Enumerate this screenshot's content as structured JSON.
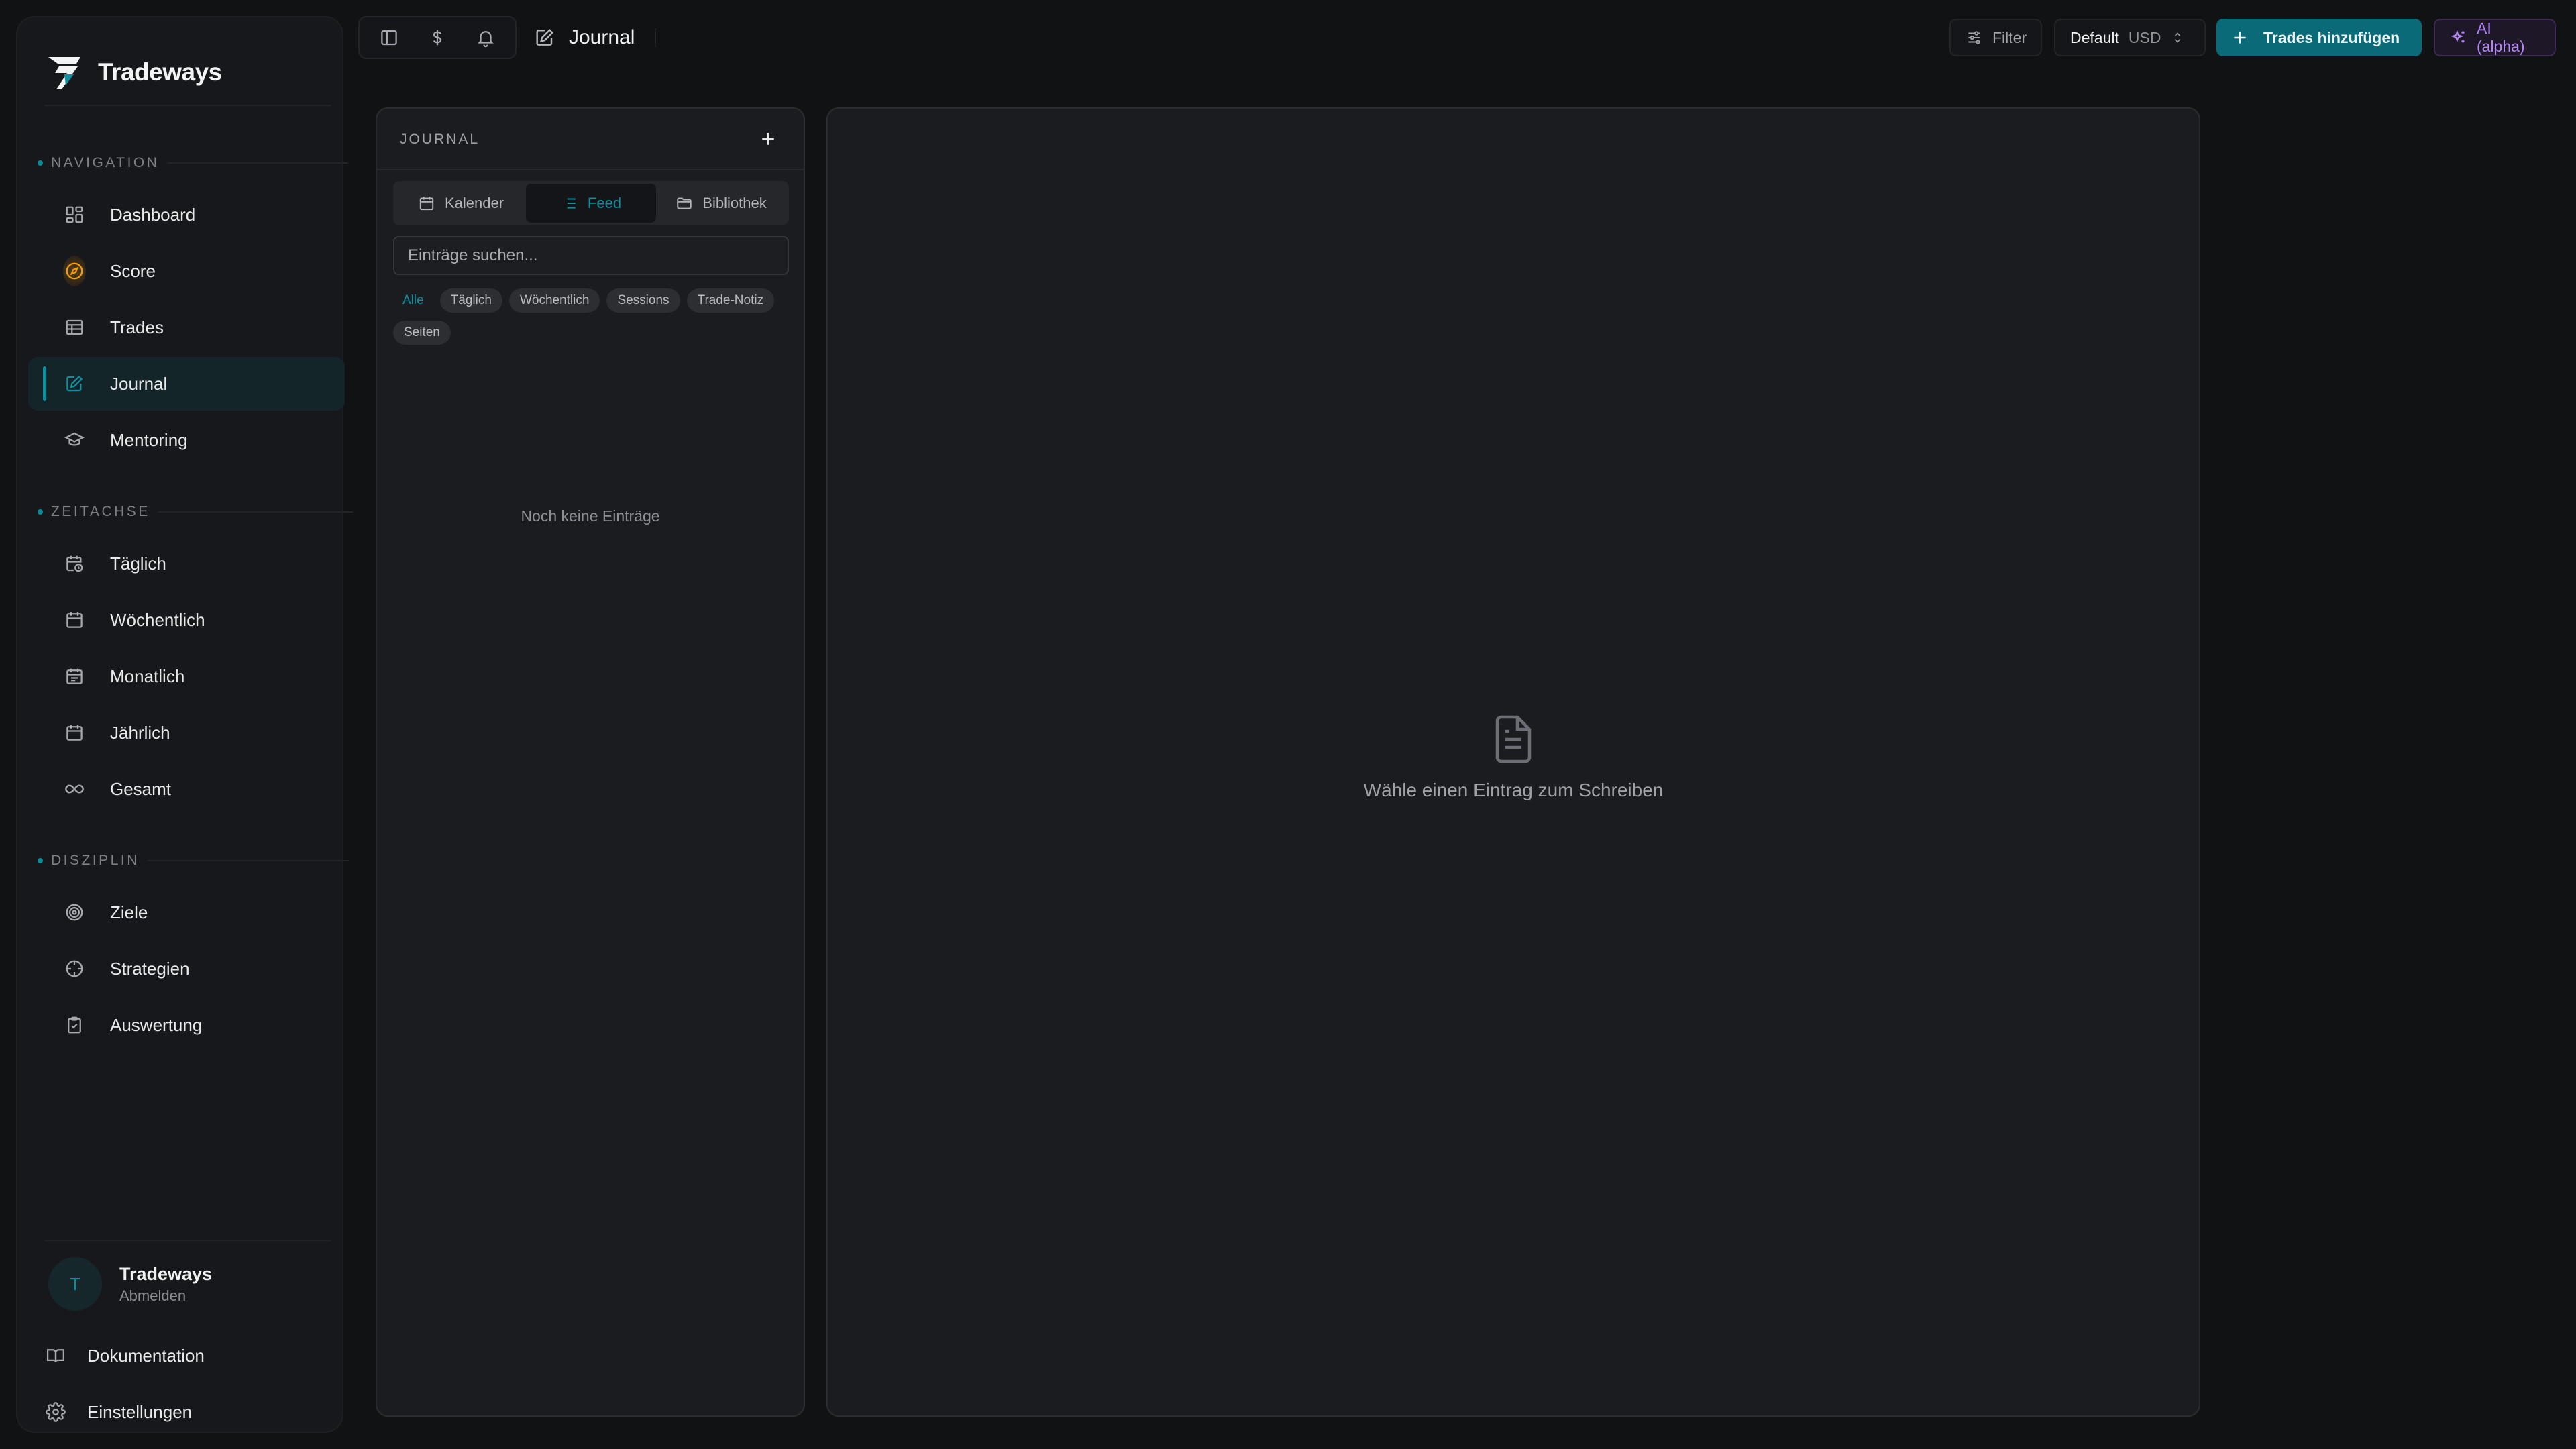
{
  "app": {
    "name": "Tradeways"
  },
  "colors": {
    "accent": "#0e8fa0",
    "background": "#111214",
    "panel": "#1b1c1f",
    "ai": "#b487f5",
    "score": "#f59e0b"
  },
  "sidebar": {
    "sections": [
      {
        "label": "NAVIGATION",
        "items": [
          {
            "label": "Dashboard",
            "icon": "dashboard-grid-icon"
          },
          {
            "label": "Score",
            "icon": "compass-icon"
          },
          {
            "label": "Trades",
            "icon": "table-icon"
          },
          {
            "label": "Journal",
            "icon": "edit-square-icon",
            "active": true
          },
          {
            "label": "Mentoring",
            "icon": "graduation-cap-icon"
          }
        ]
      },
      {
        "label": "ZEITACHSE",
        "items": [
          {
            "label": "Täglich",
            "icon": "calendar-clock-icon"
          },
          {
            "label": "Wöchentlich",
            "icon": "calendar-days-icon"
          },
          {
            "label": "Monatlich",
            "icon": "calendar-icon"
          },
          {
            "label": "Jährlich",
            "icon": "calendar-year-icon"
          },
          {
            "label": "Gesamt",
            "icon": "infinity-icon"
          }
        ]
      },
      {
        "label": "DISZIPLIN",
        "items": [
          {
            "label": "Ziele",
            "icon": "target-icon"
          },
          {
            "label": "Strategien",
            "icon": "crosshair-icon"
          },
          {
            "label": "Auswertung",
            "icon": "clipboard-check-icon"
          }
        ]
      }
    ],
    "user": {
      "initial": "T",
      "name": "Tradeways",
      "action": "Abmelden"
    },
    "footer": [
      {
        "label": "Dokumentation",
        "icon": "book-icon"
      },
      {
        "label": "Einstellungen",
        "icon": "settings-gear-icon"
      }
    ]
  },
  "topbar": {
    "breadcrumb": "Journal",
    "filter_label": "Filter",
    "account_label": "Default",
    "currency": "USD",
    "add_label": "Trades hinzufügen",
    "ai_label": "AI (alpha)"
  },
  "journal": {
    "title": "JOURNAL",
    "tabs": [
      "Kalender",
      "Feed",
      "Bibliothek"
    ],
    "active_tab": "Feed",
    "search_placeholder": "Einträge suchen...",
    "chips": [
      "Alle",
      "Täglich",
      "Wöchentlich",
      "Sessions",
      "Trade-Notiz",
      "Seiten"
    ],
    "active_chip": "Alle",
    "empty_text": "Noch keine Einträge"
  },
  "editor": {
    "empty_text": "Wähle einen Eintrag zum Schreiben"
  }
}
